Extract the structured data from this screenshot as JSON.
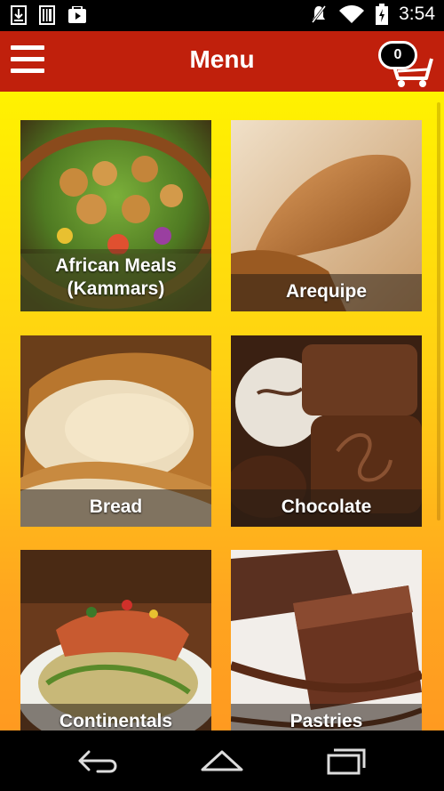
{
  "status_bar": {
    "time": "3:54"
  },
  "app_bar": {
    "title": "Menu",
    "cart_count": "0"
  },
  "categories": [
    {
      "label": "African Meals\n(Kammars)"
    },
    {
      "label": "Arequipe"
    },
    {
      "label": "Bread"
    },
    {
      "label": "Chocolate"
    },
    {
      "label": "Continentals"
    },
    {
      "label": "Pastries"
    }
  ],
  "colors": {
    "app_bar": "#c0200c",
    "content_top": "#fff200",
    "content_bottom": "#ff9a20"
  }
}
